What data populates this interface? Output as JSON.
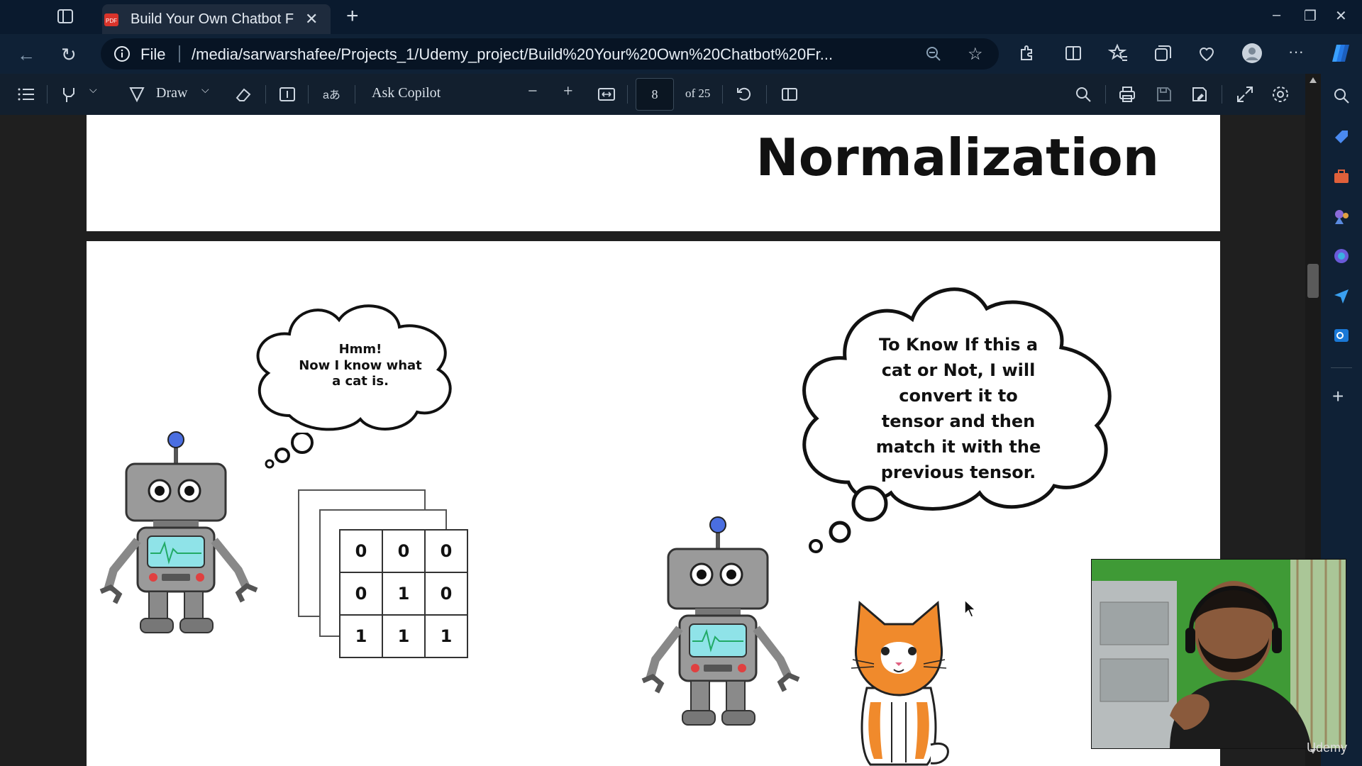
{
  "browser": {
    "tab_title": "Build Your Own Chatbot F",
    "tab_close": "✕",
    "new_tab": "+",
    "url_scheme": "File",
    "url": "/media/sarwarshafee/Projects_1/Udemy_project/Build%20Your%20Own%20Chatbot%20Fr...",
    "window_controls": {
      "minimize": "–",
      "restore": "❐",
      "close": "✕"
    }
  },
  "pdf_toolbar": {
    "draw_label": "Draw",
    "ask_copilot_label": "Ask Copilot",
    "page_number": "8",
    "page_total": "of 25"
  },
  "slide": {
    "title": "Normalization",
    "left_thought": [
      "Hmm!",
      "Now I know what",
      "a cat is."
    ],
    "right_thought": [
      "To Know If this a",
      "cat or Not, I will",
      "convert it to",
      "tensor and then",
      "match it with the",
      "previous tensor."
    ],
    "tensor_grid": [
      [
        "0",
        "0",
        "0"
      ],
      [
        "0",
        "1",
        "0"
      ],
      [
        "1",
        "1",
        "1"
      ]
    ]
  },
  "watermark": "Udemy",
  "colors": {
    "tab_bg": "#0a1a2e",
    "address_bg": "#0f2136",
    "pdf_toolbar_bg": "#121f2e",
    "robot_gray": "#9a9a9a",
    "robot_screen": "#8fe3e8",
    "cat_orange": "#f08a2c"
  }
}
